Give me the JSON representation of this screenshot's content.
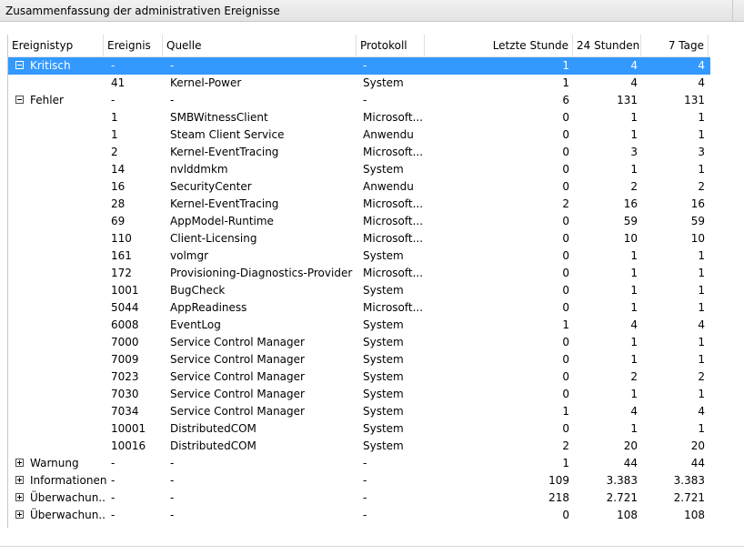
{
  "window": {
    "title": "Zusammenfassung der administrativen Ereignisse"
  },
  "columns": [
    "Ereignistyp",
    "Ereignis",
    "Quelle",
    "Protokoll",
    "Letzte Stunde",
    "24 Stunden",
    "7 Tage"
  ],
  "rows": [
    {
      "type": "Kritisch",
      "id": "-",
      "source": "-",
      "log": "-",
      "hour": "1",
      "day": "4",
      "week": "4",
      "expander": "minus",
      "selected": true
    },
    {
      "type": "",
      "id": "41",
      "source": "Kernel-Power",
      "log": "System",
      "hour": "1",
      "day": "4",
      "week": "4"
    },
    {
      "type": "Fehler",
      "id": "-",
      "source": "-",
      "log": "-",
      "hour": "6",
      "day": "131",
      "week": "131",
      "expander": "minus"
    },
    {
      "type": "",
      "id": "1",
      "source": "SMBWitnessClient",
      "log": "Microsoft...",
      "hour": "0",
      "day": "1",
      "week": "1"
    },
    {
      "type": "",
      "id": "1",
      "source": "Steam Client Service",
      "log": "Anwendu",
      "hour": "0",
      "day": "1",
      "week": "1"
    },
    {
      "type": "",
      "id": "2",
      "source": "Kernel-EventTracing",
      "log": "Microsoft...",
      "hour": "0",
      "day": "3",
      "week": "3"
    },
    {
      "type": "",
      "id": "14",
      "source": "nvlddmkm",
      "log": "System",
      "hour": "0",
      "day": "1",
      "week": "1"
    },
    {
      "type": "",
      "id": "16",
      "source": "SecurityCenter",
      "log": "Anwendu",
      "hour": "0",
      "day": "2",
      "week": "2"
    },
    {
      "type": "",
      "id": "28",
      "source": "Kernel-EventTracing",
      "log": "Microsoft...",
      "hour": "2",
      "day": "16",
      "week": "16"
    },
    {
      "type": "",
      "id": "69",
      "source": "AppModel-Runtime",
      "log": "Microsoft...",
      "hour": "0",
      "day": "59",
      "week": "59"
    },
    {
      "type": "",
      "id": "110",
      "source": "Client-Licensing",
      "log": "Microsoft...",
      "hour": "0",
      "day": "10",
      "week": "10"
    },
    {
      "type": "",
      "id": "161",
      "source": "volmgr",
      "log": "System",
      "hour": "0",
      "day": "1",
      "week": "1"
    },
    {
      "type": "",
      "id": "172",
      "source": "Provisioning-Diagnostics-Provider",
      "log": "Microsoft...",
      "hour": "0",
      "day": "1",
      "week": "1"
    },
    {
      "type": "",
      "id": "1001",
      "source": "BugCheck",
      "log": "System",
      "hour": "0",
      "day": "1",
      "week": "1"
    },
    {
      "type": "",
      "id": "5044",
      "source": "AppReadiness",
      "log": "Microsoft...",
      "hour": "0",
      "day": "1",
      "week": "1"
    },
    {
      "type": "",
      "id": "6008",
      "source": "EventLog",
      "log": "System",
      "hour": "1",
      "day": "4",
      "week": "4"
    },
    {
      "type": "",
      "id": "7000",
      "source": "Service Control Manager",
      "log": "System",
      "hour": "0",
      "day": "1",
      "week": "1"
    },
    {
      "type": "",
      "id": "7009",
      "source": "Service Control Manager",
      "log": "System",
      "hour": "0",
      "day": "1",
      "week": "1"
    },
    {
      "type": "",
      "id": "7023",
      "source": "Service Control Manager",
      "log": "System",
      "hour": "0",
      "day": "2",
      "week": "2"
    },
    {
      "type": "",
      "id": "7030",
      "source": "Service Control Manager",
      "log": "System",
      "hour": "0",
      "day": "1",
      "week": "1"
    },
    {
      "type": "",
      "id": "7034",
      "source": "Service Control Manager",
      "log": "System",
      "hour": "1",
      "day": "4",
      "week": "4"
    },
    {
      "type": "",
      "id": "10001",
      "source": "DistributedCOM",
      "log": "System",
      "hour": "0",
      "day": "1",
      "week": "1"
    },
    {
      "type": "",
      "id": "10016",
      "source": "DistributedCOM",
      "log": "System",
      "hour": "2",
      "day": "20",
      "week": "20"
    },
    {
      "type": "Warnung",
      "id": "-",
      "source": "-",
      "log": "-",
      "hour": "1",
      "day": "44",
      "week": "44",
      "expander": "plus"
    },
    {
      "type": "Informationen",
      "id": "-",
      "source": "-",
      "log": "-",
      "hour": "109",
      "day": "3.383",
      "week": "3.383",
      "expander": "plus"
    },
    {
      "type": "Überwachun...",
      "id": "-",
      "source": "-",
      "log": "-",
      "hour": "218",
      "day": "2.721",
      "week": "2.721",
      "expander": "plus"
    },
    {
      "type": "Überwachun...",
      "id": "-",
      "source": "-",
      "log": "-",
      "hour": "0",
      "day": "108",
      "week": "108",
      "expander": "plus"
    }
  ]
}
